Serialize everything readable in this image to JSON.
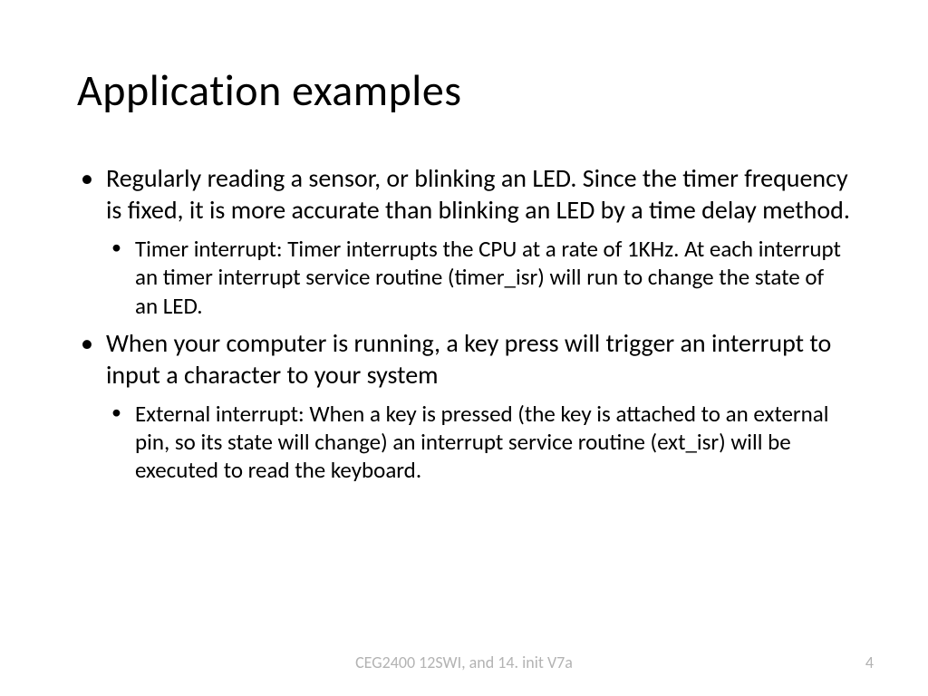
{
  "title": "Application examples",
  "bullets": {
    "b1": "Regularly reading a sensor, or blinking an LED. Since the timer frequency is fixed, it is more accurate than blinking an LED by a time delay method.",
    "b1a": "Timer interrupt: Timer interrupts the CPU at a rate of 1KHz. At each interrupt an timer interrupt service routine (timer_isr) will run to change the state of an LED.",
    "b2": "When your computer is running, a key press will trigger an interrupt to input a character to your system",
    "b2a": "External interrupt: When a key is pressed (the key is attached to an external pin, so its state will change) an interrupt service routine (ext_isr) will be executed to read the keyboard."
  },
  "footer": "CEG2400 12SWI, and 14. init V7a",
  "page": "4"
}
